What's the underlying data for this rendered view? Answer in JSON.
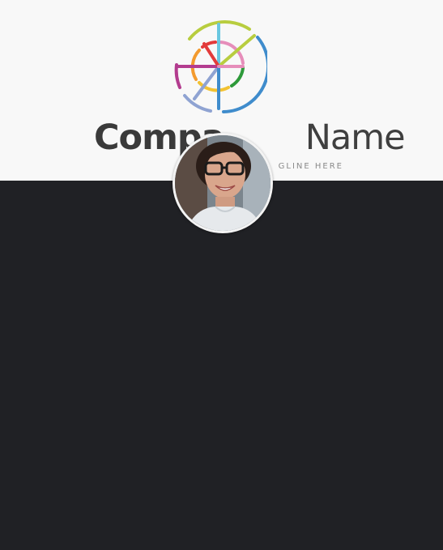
{
  "header": {
    "brand_part1": "Compa",
    "brand_part2": "Name",
    "tagline": "GLINE HERE"
  },
  "icons": {
    "logo": "segmented-wheel-logo-icon",
    "avatar": "user-avatar-photo"
  },
  "colors": {
    "header_background": "#f8f8f8",
    "page_background": "#202125",
    "brand_text": "#3a3a3a",
    "tagline_text": "#8a8a8a"
  }
}
